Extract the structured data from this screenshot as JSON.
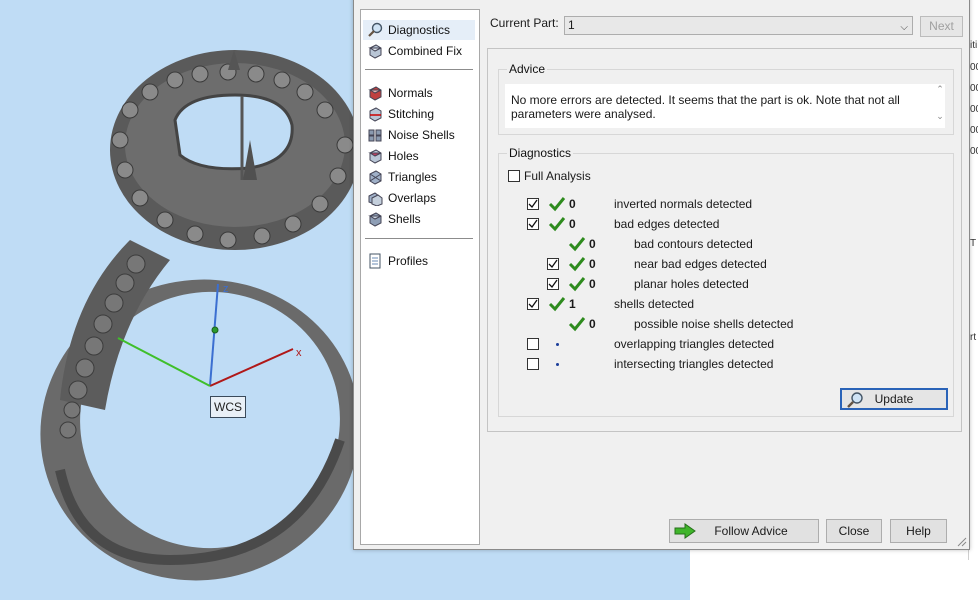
{
  "viewport": {
    "wcs_label": "WCS",
    "axis_labels": {
      "z": "z",
      "x": "x",
      "y": "y"
    },
    "colors": {
      "background": "#bfdcf5",
      "z_axis": "#3b6fd1",
      "x_axis": "#b01818",
      "y_axis": "#3fbf2a",
      "model": "#666666"
    }
  },
  "right_strip": {
    "fragments": [
      "iti",
      "00",
      "00",
      "00",
      "00",
      "00",
      "T",
      "rt"
    ]
  },
  "dialog": {
    "nav": {
      "items_top": [
        {
          "label": "Diagnostics",
          "icon": "magnifier-icon",
          "selected": true
        },
        {
          "label": "Combined Fix",
          "icon": "cube-fix-icon"
        }
      ],
      "items_mid": [
        {
          "label": "Normals",
          "icon": "normals-cube-icon"
        },
        {
          "label": "Stitching",
          "icon": "stitching-cube-icon"
        },
        {
          "label": "Noise Shells",
          "icon": "noise-shells-icon"
        },
        {
          "label": "Holes",
          "icon": "holes-cube-icon"
        },
        {
          "label": "Triangles",
          "icon": "triangles-cube-icon"
        },
        {
          "label": "Overlaps",
          "icon": "overlaps-cube-icon"
        },
        {
          "label": "Shells",
          "icon": "shells-cube-icon"
        }
      ],
      "items_bottom": [
        {
          "label": "Profiles",
          "icon": "document-icon"
        }
      ]
    },
    "current_part": {
      "label": "Current Part:",
      "value": "1",
      "next_label": "Next"
    },
    "advice": {
      "title": "Advice",
      "text": "No more errors are detected. It seems that the part is ok. Note that not all parameters were analysed."
    },
    "diagnostics": {
      "title": "Diagnostics",
      "full_analysis_label": "Full Analysis",
      "full_analysis_checked": false,
      "rows": [
        {
          "checkbox": "checked",
          "status": "ok",
          "count": "0",
          "label": "inverted normals detected",
          "indent": 0
        },
        {
          "checkbox": "checked",
          "status": "ok",
          "count": "0",
          "label": "bad edges detected",
          "indent": 0
        },
        {
          "checkbox": "none",
          "status": "ok",
          "count": "0",
          "label": "bad contours detected",
          "indent": 1
        },
        {
          "checkbox": "checked",
          "status": "ok",
          "count": "0",
          "label": "near bad edges detected",
          "indent": 1
        },
        {
          "checkbox": "checked",
          "status": "ok",
          "count": "0",
          "label": "planar holes detected",
          "indent": 1
        },
        {
          "checkbox": "checked",
          "status": "ok",
          "count": "1",
          "label": "shells detected",
          "indent": 0
        },
        {
          "checkbox": "none",
          "status": "ok",
          "count": "0",
          "label": "possible noise shells detected",
          "indent": 1
        },
        {
          "checkbox": "unchecked",
          "status": "pending",
          "count": "",
          "label": "overlapping triangles detected",
          "indent": 0
        },
        {
          "checkbox": "unchecked",
          "status": "pending",
          "count": "",
          "label": "intersecting triangles detected",
          "indent": 0
        }
      ],
      "update_label": "Update"
    },
    "footer": {
      "follow_advice": "Follow Advice",
      "close": "Close",
      "help": "Help"
    },
    "colors": {
      "check_green": "#2e8b1e",
      "accent_blue": "#2a63b8"
    }
  }
}
